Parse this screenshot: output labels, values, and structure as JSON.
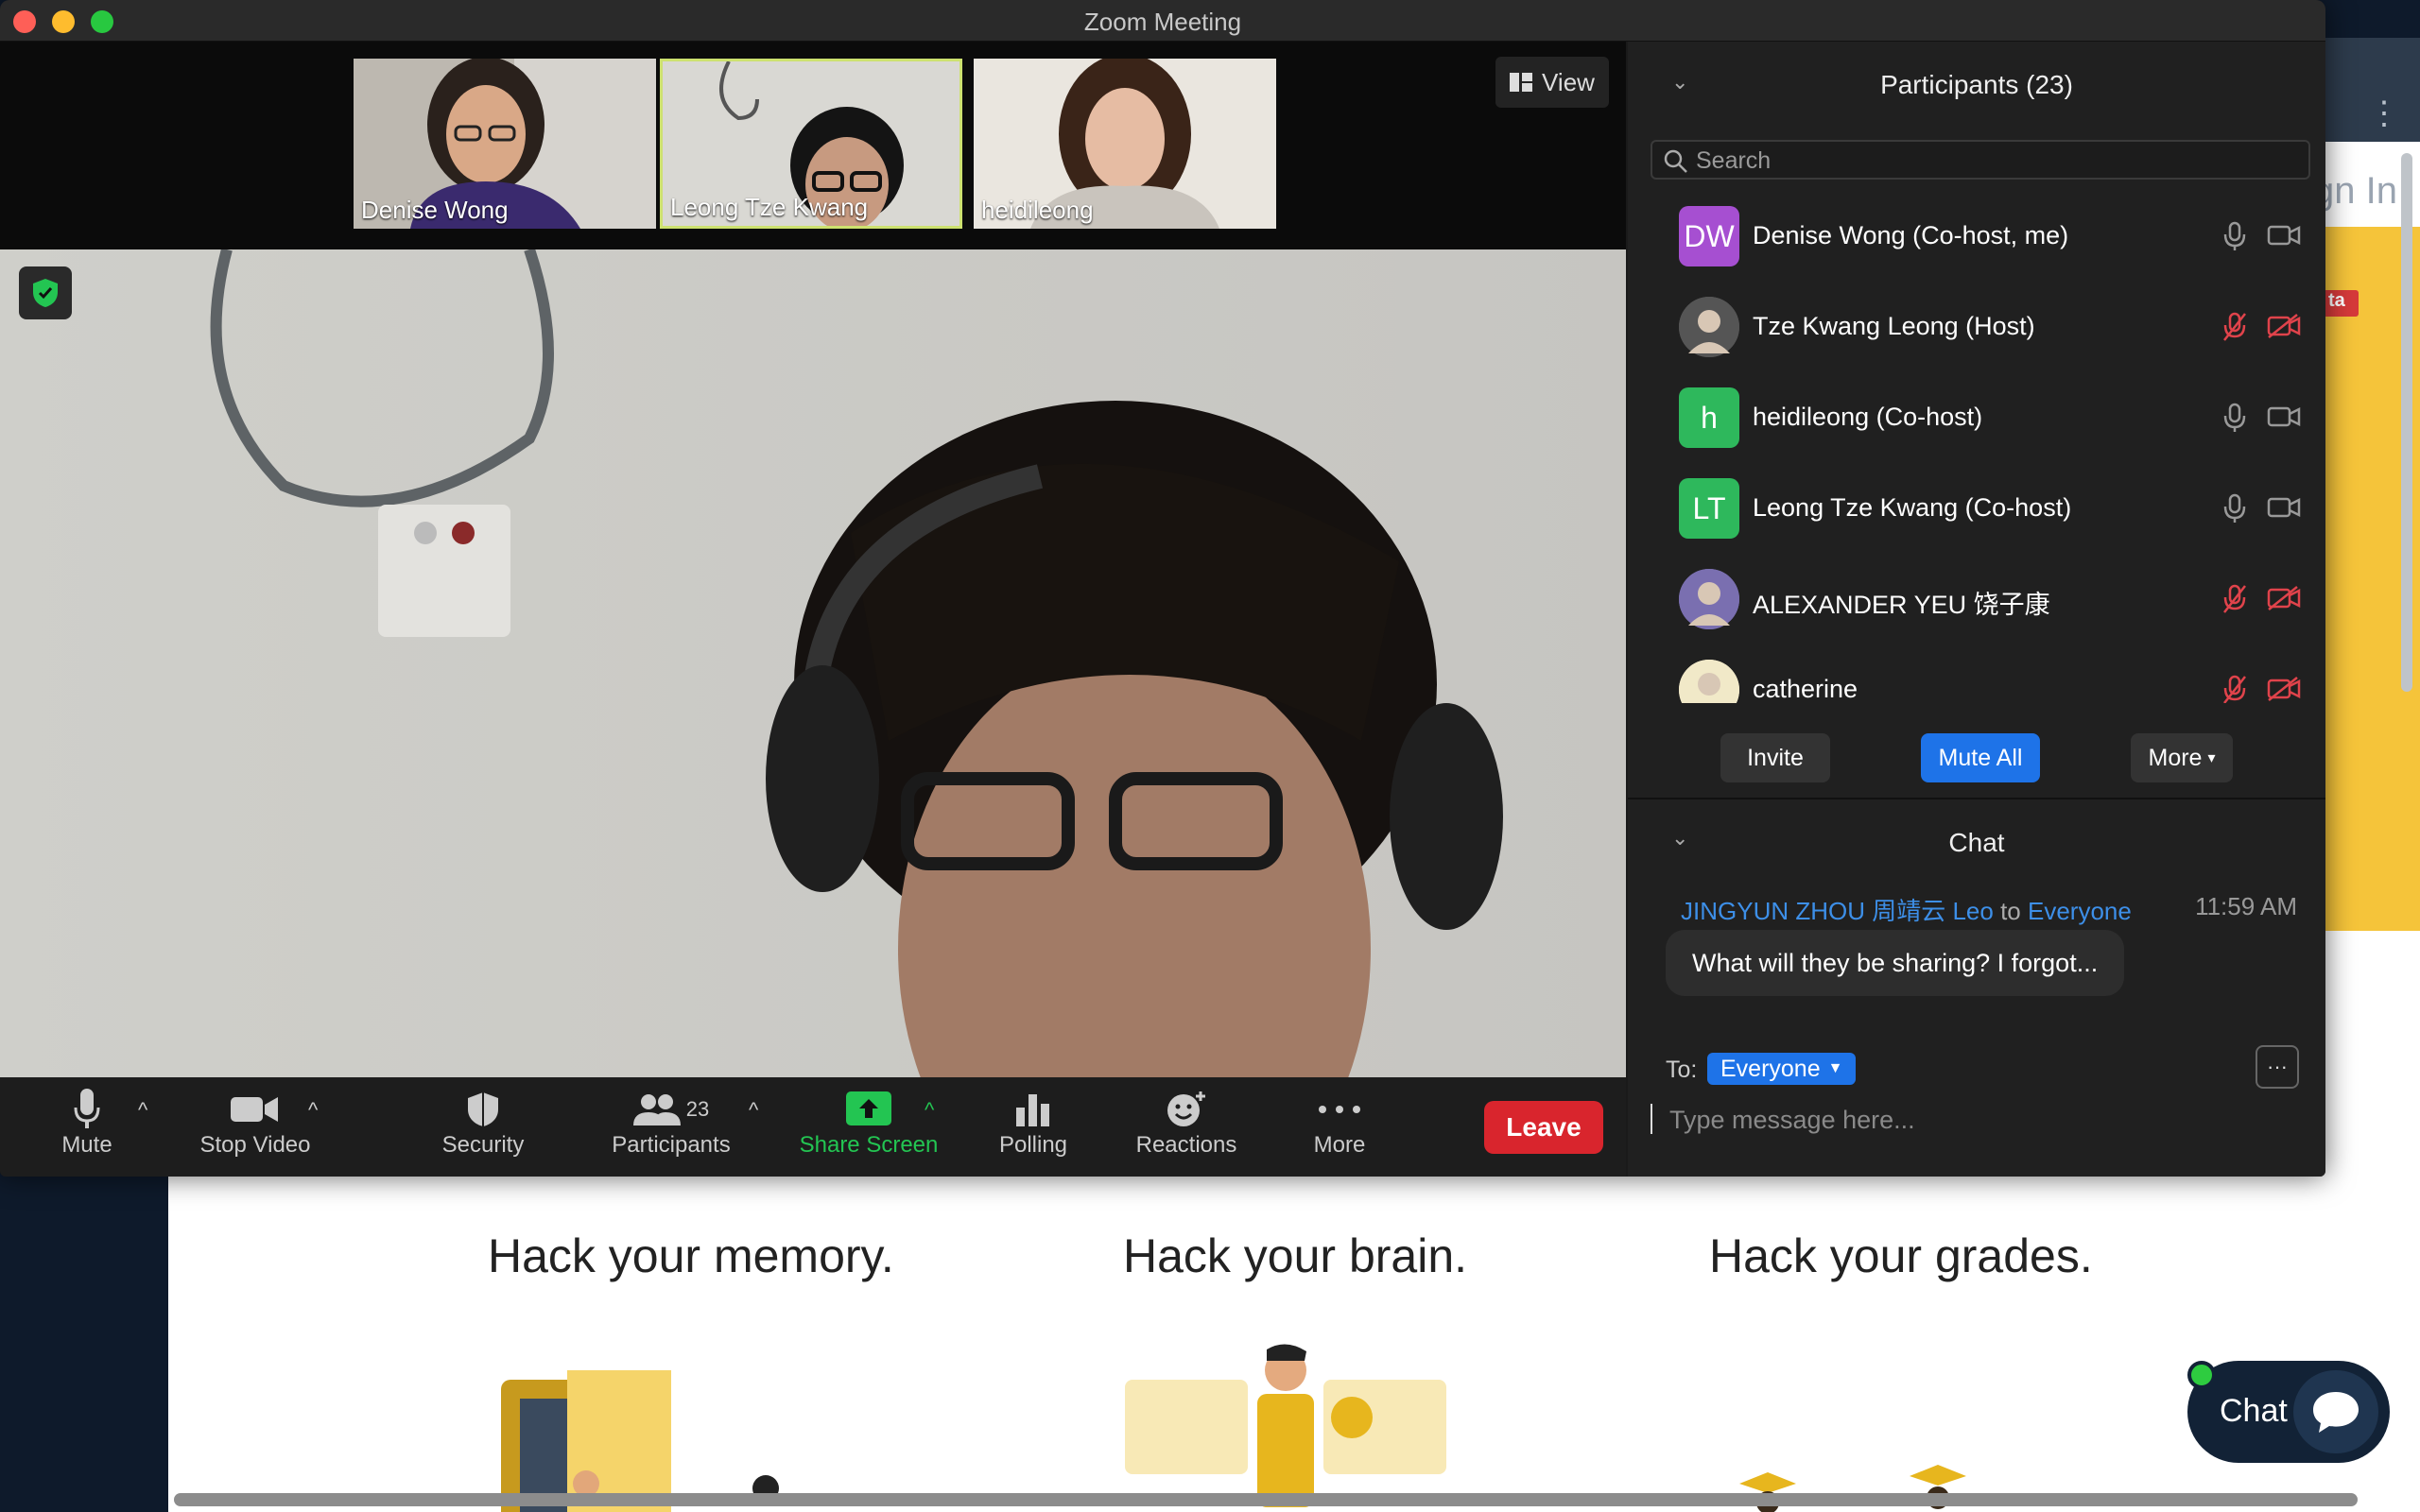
{
  "window": {
    "title": "Zoom Meeting"
  },
  "thumbnails": [
    {
      "name": "Denise Wong"
    },
    {
      "name": "Leong Tze Kwang"
    },
    {
      "name": "heidileong"
    }
  ],
  "view_label": "View",
  "toolbar": {
    "mute": "Mute",
    "stop_video": "Stop Video",
    "security": "Security",
    "participants": "Participants",
    "participants_count": "23",
    "share_screen": "Share Screen",
    "polling": "Polling",
    "reactions": "Reactions",
    "more": "More",
    "leave": "Leave"
  },
  "panel": {
    "title": "Participants (23)",
    "search_placeholder": "Search",
    "participants": [
      {
        "initials": "DW",
        "name": "Denise Wong (Co-host, me)",
        "muted": false,
        "video_off": false,
        "color": "#a64fd1"
      },
      {
        "initials": "",
        "name": "Tze Kwang Leong (Host)",
        "muted": true,
        "video_off": true,
        "color": "#555555"
      },
      {
        "initials": "h",
        "name": "heidileong (Co-host)",
        "muted": false,
        "video_off": false,
        "color": "#2eb85c"
      },
      {
        "initials": "LT",
        "name": "Leong Tze Kwang (Co-host)",
        "muted": false,
        "video_off": false,
        "color": "#2eb85c"
      },
      {
        "initials": "",
        "name": "ALEXANDER YEU 饶子康",
        "muted": true,
        "video_off": true,
        "color": "#7a6fb0"
      },
      {
        "initials": "",
        "name": "catherine",
        "muted": true,
        "video_off": true,
        "color": "#f1e9c8"
      }
    ],
    "invite": "Invite",
    "mute_all": "Mute All",
    "more": "More"
  },
  "chat": {
    "title": "Chat",
    "sender": "JINGYUN ZHOU 周靖云 Leo",
    "to_word": "to",
    "recipient": "Everyone",
    "time": "11:59 AM",
    "message": "What will they be sharing? I forgot...",
    "to_label": "To:",
    "to_value": "Everyone",
    "input_placeholder": "Type message here..."
  },
  "background": {
    "signin_fragment": "gn In",
    "badge": "ta",
    "headings": [
      "Hack your memory.",
      "Hack your brain.",
      "Hack your grades."
    ],
    "chat_widget": "Chat"
  },
  "colors": {
    "accent": "#1e73e8",
    "leave": "#d9252d",
    "share": "#23c552",
    "muted": "#e0434b"
  }
}
